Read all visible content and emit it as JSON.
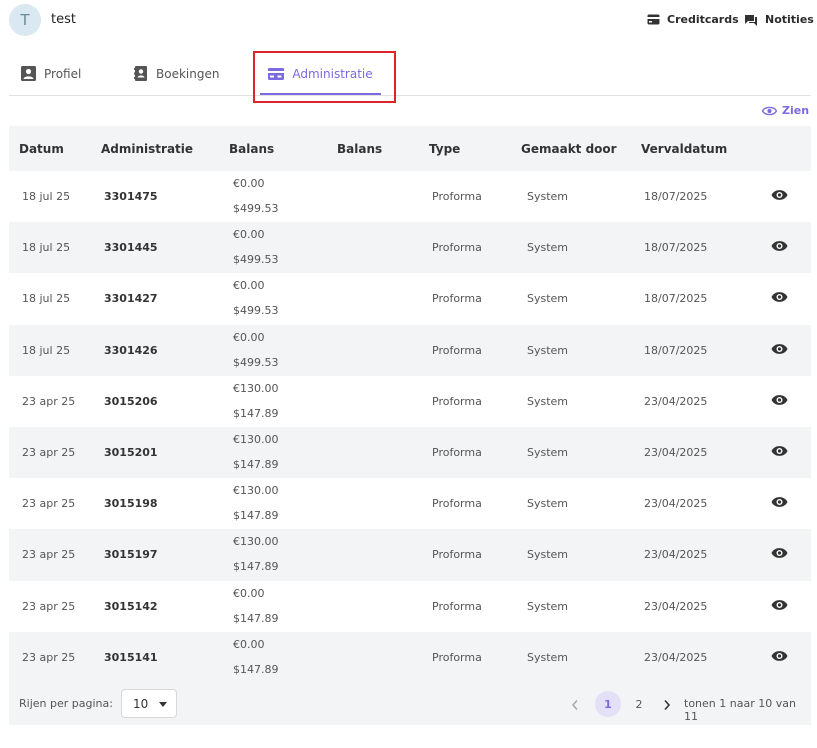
{
  "user": {
    "avatar_initial": "T",
    "name": "test"
  },
  "header_links": {
    "creditcards": "Creditcards",
    "notes": "Notities"
  },
  "tabs": {
    "profile": "Profiel",
    "bookings": "Boekingen",
    "administration": "Administratie"
  },
  "view_link": "Zien",
  "table": {
    "headers": [
      "Datum",
      "Administratie",
      "Balans",
      "Balans",
      "Type",
      "Gemaakt door",
      "Vervaldatum"
    ],
    "rows": [
      {
        "date": "18 jul 25",
        "admin": "3301475",
        "bal1": "€0.00",
        "bal2": "$499.53",
        "type": "Proforma",
        "by": "System",
        "due": "18/07/2025"
      },
      {
        "date": "18 jul 25",
        "admin": "3301445",
        "bal1": "€0.00",
        "bal2": "$499.53",
        "type": "Proforma",
        "by": "System",
        "due": "18/07/2025"
      },
      {
        "date": "18 jul 25",
        "admin": "3301427",
        "bal1": "€0.00",
        "bal2": "$499.53",
        "type": "Proforma",
        "by": "System",
        "due": "18/07/2025"
      },
      {
        "date": "18 jul 25",
        "admin": "3301426",
        "bal1": "€0.00",
        "bal2": "$499.53",
        "type": "Proforma",
        "by": "System",
        "due": "18/07/2025"
      },
      {
        "date": "23 apr 25",
        "admin": "3015206",
        "bal1": "€130.00",
        "bal2": "$147.89",
        "type": "Proforma",
        "by": "System",
        "due": "23/04/2025"
      },
      {
        "date": "23 apr 25",
        "admin": "3015201",
        "bal1": "€130.00",
        "bal2": "$147.89",
        "type": "Proforma",
        "by": "System",
        "due": "23/04/2025"
      },
      {
        "date": "23 apr 25",
        "admin": "3015198",
        "bal1": "€130.00",
        "bal2": "$147.89",
        "type": "Proforma",
        "by": "System",
        "due": "23/04/2025"
      },
      {
        "date": "23 apr 25",
        "admin": "3015197",
        "bal1": "€130.00",
        "bal2": "$147.89",
        "type": "Proforma",
        "by": "System",
        "due": "23/04/2025"
      },
      {
        "date": "23 apr 25",
        "admin": "3015142",
        "bal1": "€0.00",
        "bal2": "$147.89",
        "type": "Proforma",
        "by": "System",
        "due": "23/04/2025"
      },
      {
        "date": "23 apr 25",
        "admin": "3015141",
        "bal1": "€0.00",
        "bal2": "$147.89",
        "type": "Proforma",
        "by": "System",
        "due": "23/04/2025"
      }
    ]
  },
  "pagination": {
    "rows_per_page_label": "Rijen per pagina:",
    "rows_per_page_value": "10",
    "pages": [
      "1",
      "2"
    ],
    "current_page": "1",
    "info": "tonen 1 naar 10 van 11"
  },
  "colors": {
    "accent": "#7b6ae0",
    "highlight_box": "#d9262b",
    "row_alt": "#f3f4f6"
  }
}
